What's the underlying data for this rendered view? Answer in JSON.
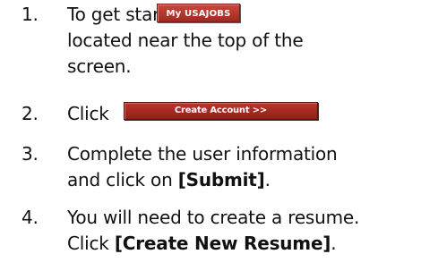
{
  "steps": [
    {
      "number": "1.",
      "line1": "To get started, click",
      "button": "My USAJOBS",
      "line2": "located near the top of the",
      "line3": "screen."
    },
    {
      "number": "2.",
      "line1": "Click",
      "button": "Create Account >>"
    },
    {
      "number": "3.",
      "line1": "Complete the user information",
      "line2_prefix": "and click on ",
      "line2_bold": "[Submit]",
      "line2_suffix": "."
    },
    {
      "number": "4.",
      "line1": "You will need to create a resume.",
      "line2_prefix": "Click ",
      "line2_bold": "[Create New Resume]",
      "line2_suffix": "."
    }
  ],
  "colors": {
    "button_red": "#a52d24",
    "text": "#111111"
  }
}
